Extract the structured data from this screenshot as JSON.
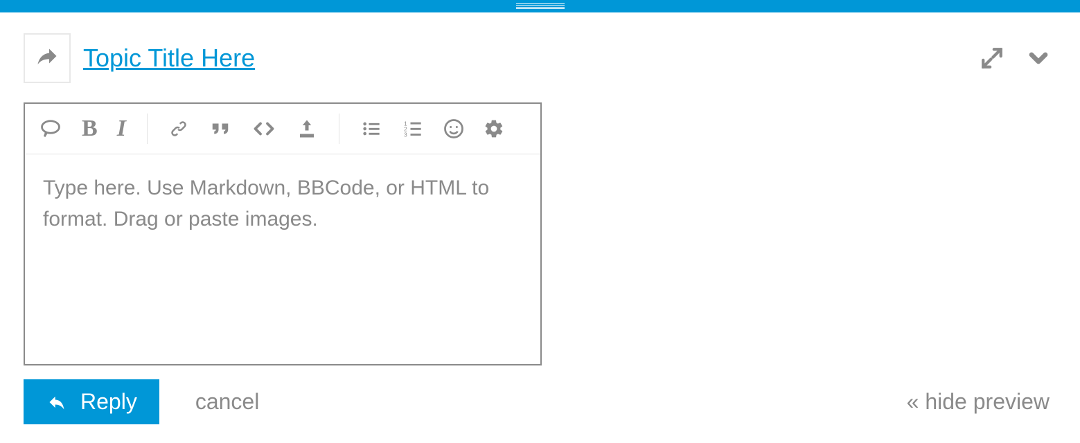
{
  "header": {
    "topic_title": "Topic Title Here"
  },
  "editor": {
    "placeholder": "Type here. Use Markdown, BBCode, or HTML to format. Drag or paste images.",
    "value": ""
  },
  "actions": {
    "reply_label": "Reply",
    "cancel_label": "cancel",
    "hide_preview_label": "« hide preview"
  },
  "toolbar": {
    "items": [
      "speech-bubble",
      "bold",
      "italic",
      "link",
      "quote",
      "code",
      "upload",
      "bullet-list",
      "numbered-list",
      "emoji",
      "settings"
    ]
  },
  "colors": {
    "accent": "#0097d7",
    "muted": "#8a8a8a"
  }
}
